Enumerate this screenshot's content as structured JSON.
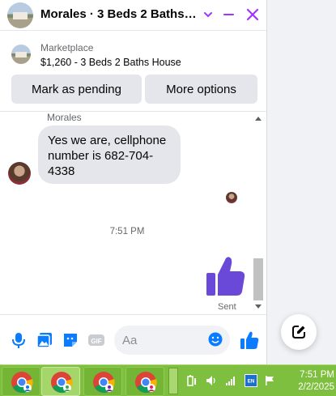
{
  "header": {
    "title": "Morales · 3 Beds 2 Baths H...",
    "accent_color": "#a033ff"
  },
  "listing": {
    "source": "Marketplace",
    "title": "$1,260 - 3 Beds 2 Baths House",
    "actions": {
      "pending": "Mark as pending",
      "more": "More options"
    }
  },
  "conversation": {
    "sender_name": "Morales",
    "message": "Yes we are, cellphone number is 682-704-4338",
    "timestamp": "7:51 PM",
    "sent_status": "Sent",
    "like_color": "#6a49d9"
  },
  "composer": {
    "placeholder": "Aa",
    "icons": [
      "microphone-icon",
      "photo-icon",
      "sticker-icon",
      "gif-icon",
      "emoji-icon",
      "like-icon"
    ],
    "gif_label": "GIF"
  },
  "new_message": {
    "icon": "compose-icon"
  },
  "taskbar": {
    "apps": [
      "chrome-profile-1",
      "chrome-profile-2",
      "chrome-profile-3",
      "chrome-profile-4"
    ],
    "clock_time": "7:51 PM",
    "clock_date": "2/2/2025",
    "tray_label": "EN"
  }
}
